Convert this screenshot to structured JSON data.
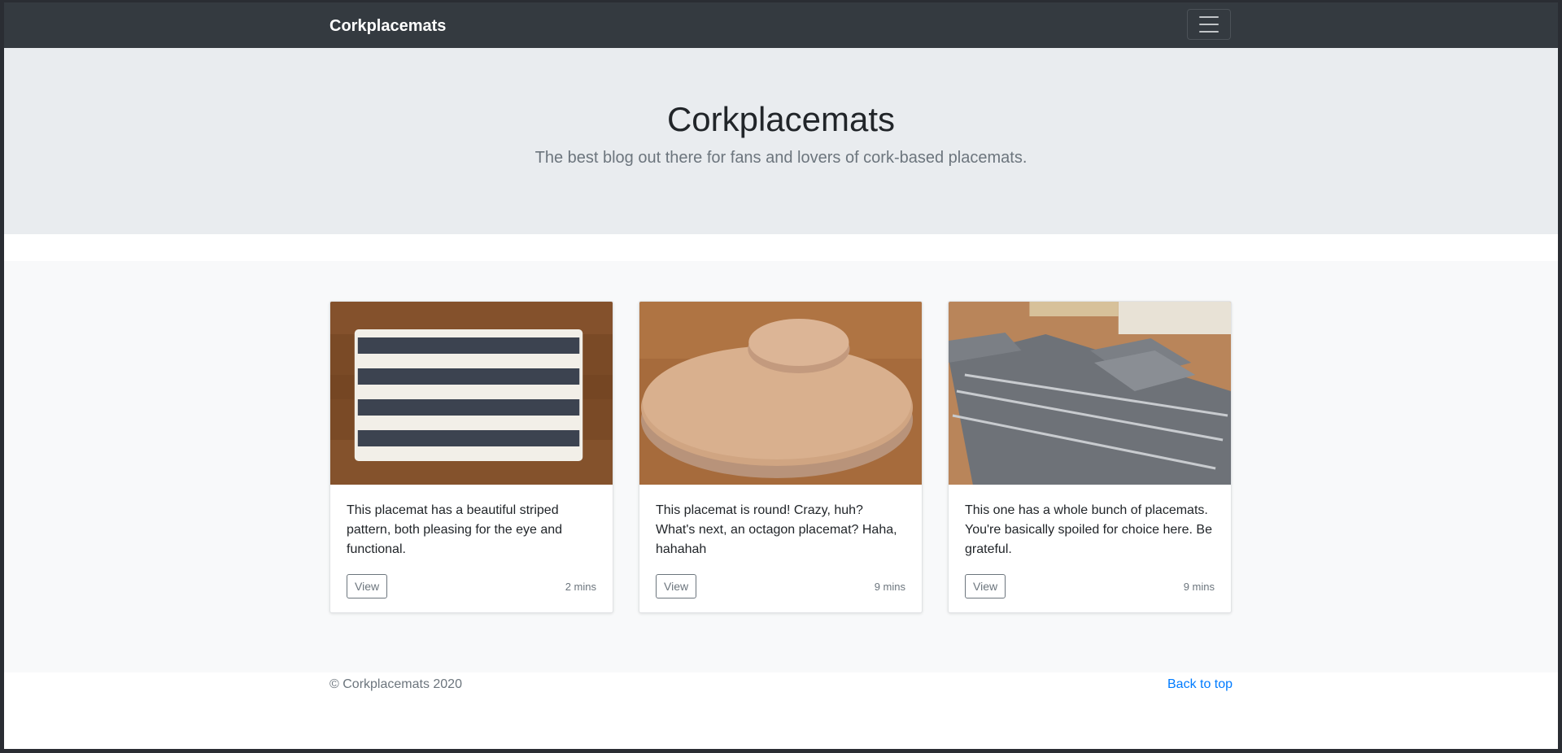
{
  "navbar": {
    "brand": "Corkplacemats",
    "toggler_icon": "hamburger-menu-icon"
  },
  "hero": {
    "title": "Corkplacemats",
    "subtitle": "The best blog out there for fans and lovers of cork-based placemats."
  },
  "cards": [
    {
      "text": "This placemat has a beautiful striped pattern, both pleasing for the eye and functional.",
      "button": "View",
      "time": "2 mins"
    },
    {
      "text": "This placemat is round! Crazy, huh? What's next, an octagon placemat? Haha, hahahah",
      "button": "View",
      "time": "9 mins"
    },
    {
      "text": "This one has a whole bunch of placemats. You're basically spoiled for choice here. Be grateful.",
      "button": "View",
      "time": "9 mins"
    }
  ],
  "footer": {
    "copyright": "© Corkplacemats 2020",
    "back_to_top": "Back to top"
  },
  "colors": {
    "navbar": "#343a40",
    "hero_bg": "#e9ecef",
    "link": "#007bff",
    "muted": "#6c757d"
  }
}
